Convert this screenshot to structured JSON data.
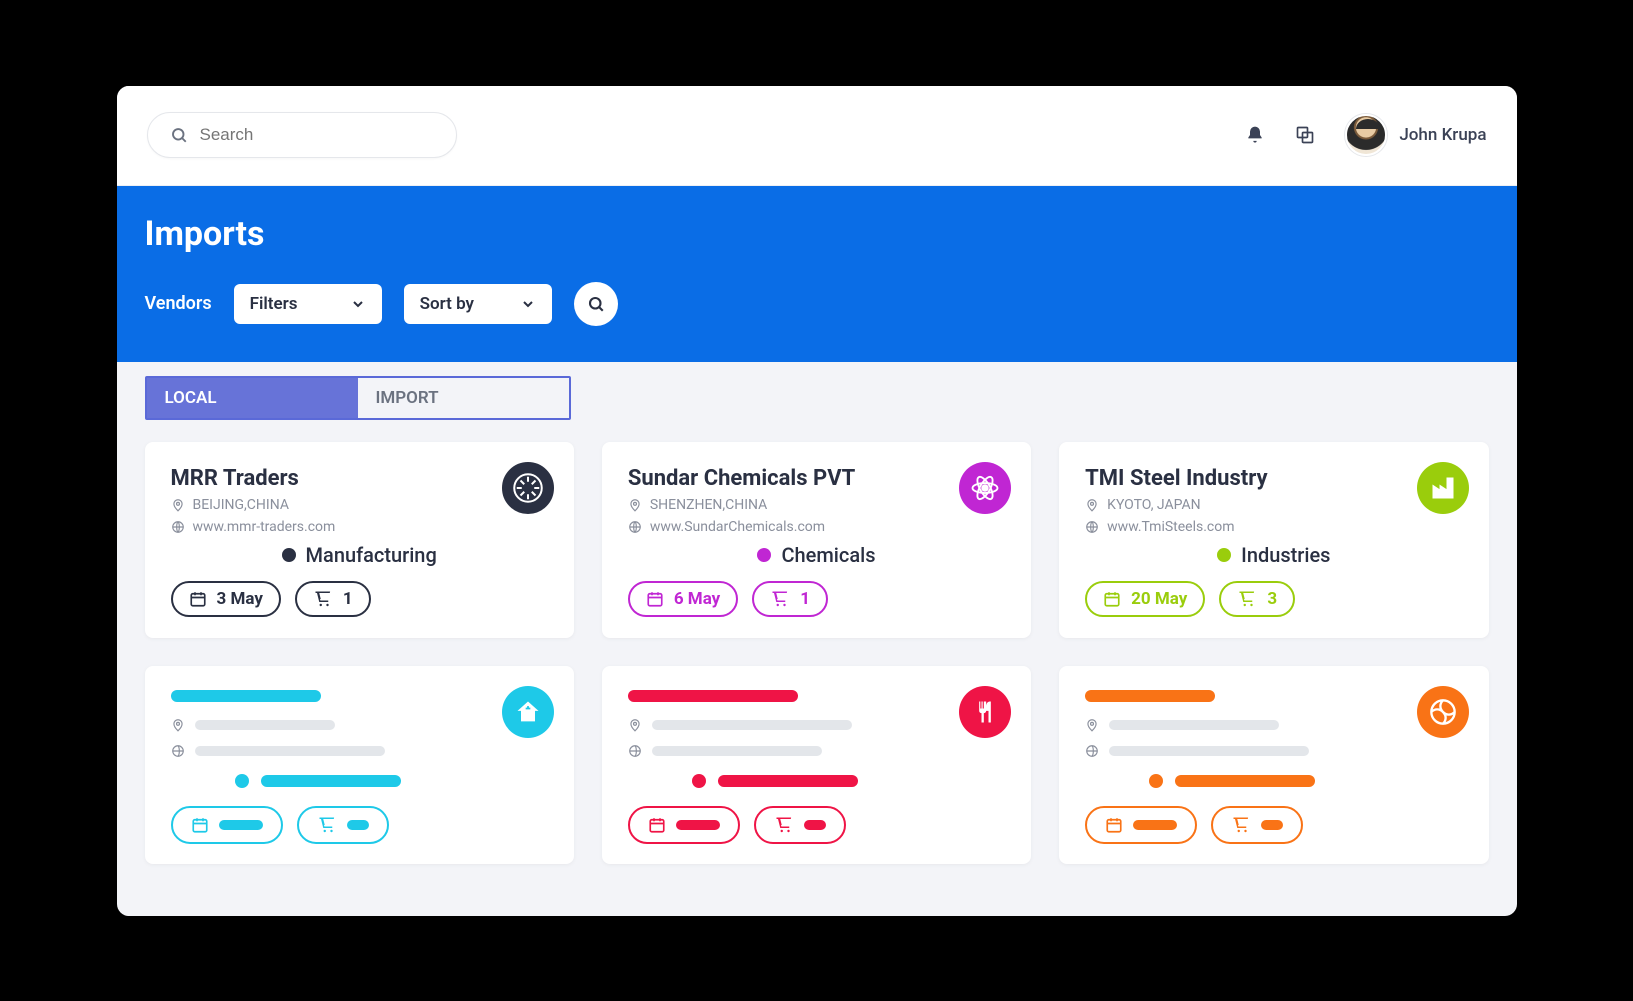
{
  "header": {
    "search_placeholder": "Search",
    "username": "John Krupa"
  },
  "bluebar": {
    "title": "Imports",
    "vendors_label": "Vendors",
    "filters_label": "Filters",
    "sort_label": "Sort by"
  },
  "tabs": [
    {
      "key": "local",
      "label": "LOCAL",
      "active": true
    },
    {
      "key": "import",
      "label": "IMPORT",
      "active": false
    }
  ],
  "cards": [
    {
      "title": "MRR Traders",
      "location": "BEIJING,CHINA",
      "website": "www.mmr-traders.com",
      "category": "Manufacturing",
      "date": "3 May",
      "cart": "1",
      "color": "#2a3042",
      "accent": "#2a3042",
      "icon": "manufacturing"
    },
    {
      "title": "Sundar Chemicals PVT",
      "location": "SHENZHEN,CHINA",
      "website": "www.SundarChemicals.com",
      "category": "Chemicals",
      "date": "6 May",
      "cart": "1",
      "color": "#c026d3",
      "accent": "#c026d3",
      "icon": "chemicals"
    },
    {
      "title": "TMI Steel Industry",
      "location": "KYOTO, JAPAN",
      "website": "www.TmiSteels.com",
      "category": "Industries",
      "date": "20 May",
      "cart": "3",
      "color": "#9acd0c",
      "accent": "#9acd0c",
      "icon": "industries"
    }
  ],
  "skeletons": [
    {
      "color": "#1ec9e8",
      "icon": "home"
    },
    {
      "color": "#ef1446",
      "icon": "food"
    },
    {
      "color": "#f97316",
      "icon": "sports"
    }
  ]
}
